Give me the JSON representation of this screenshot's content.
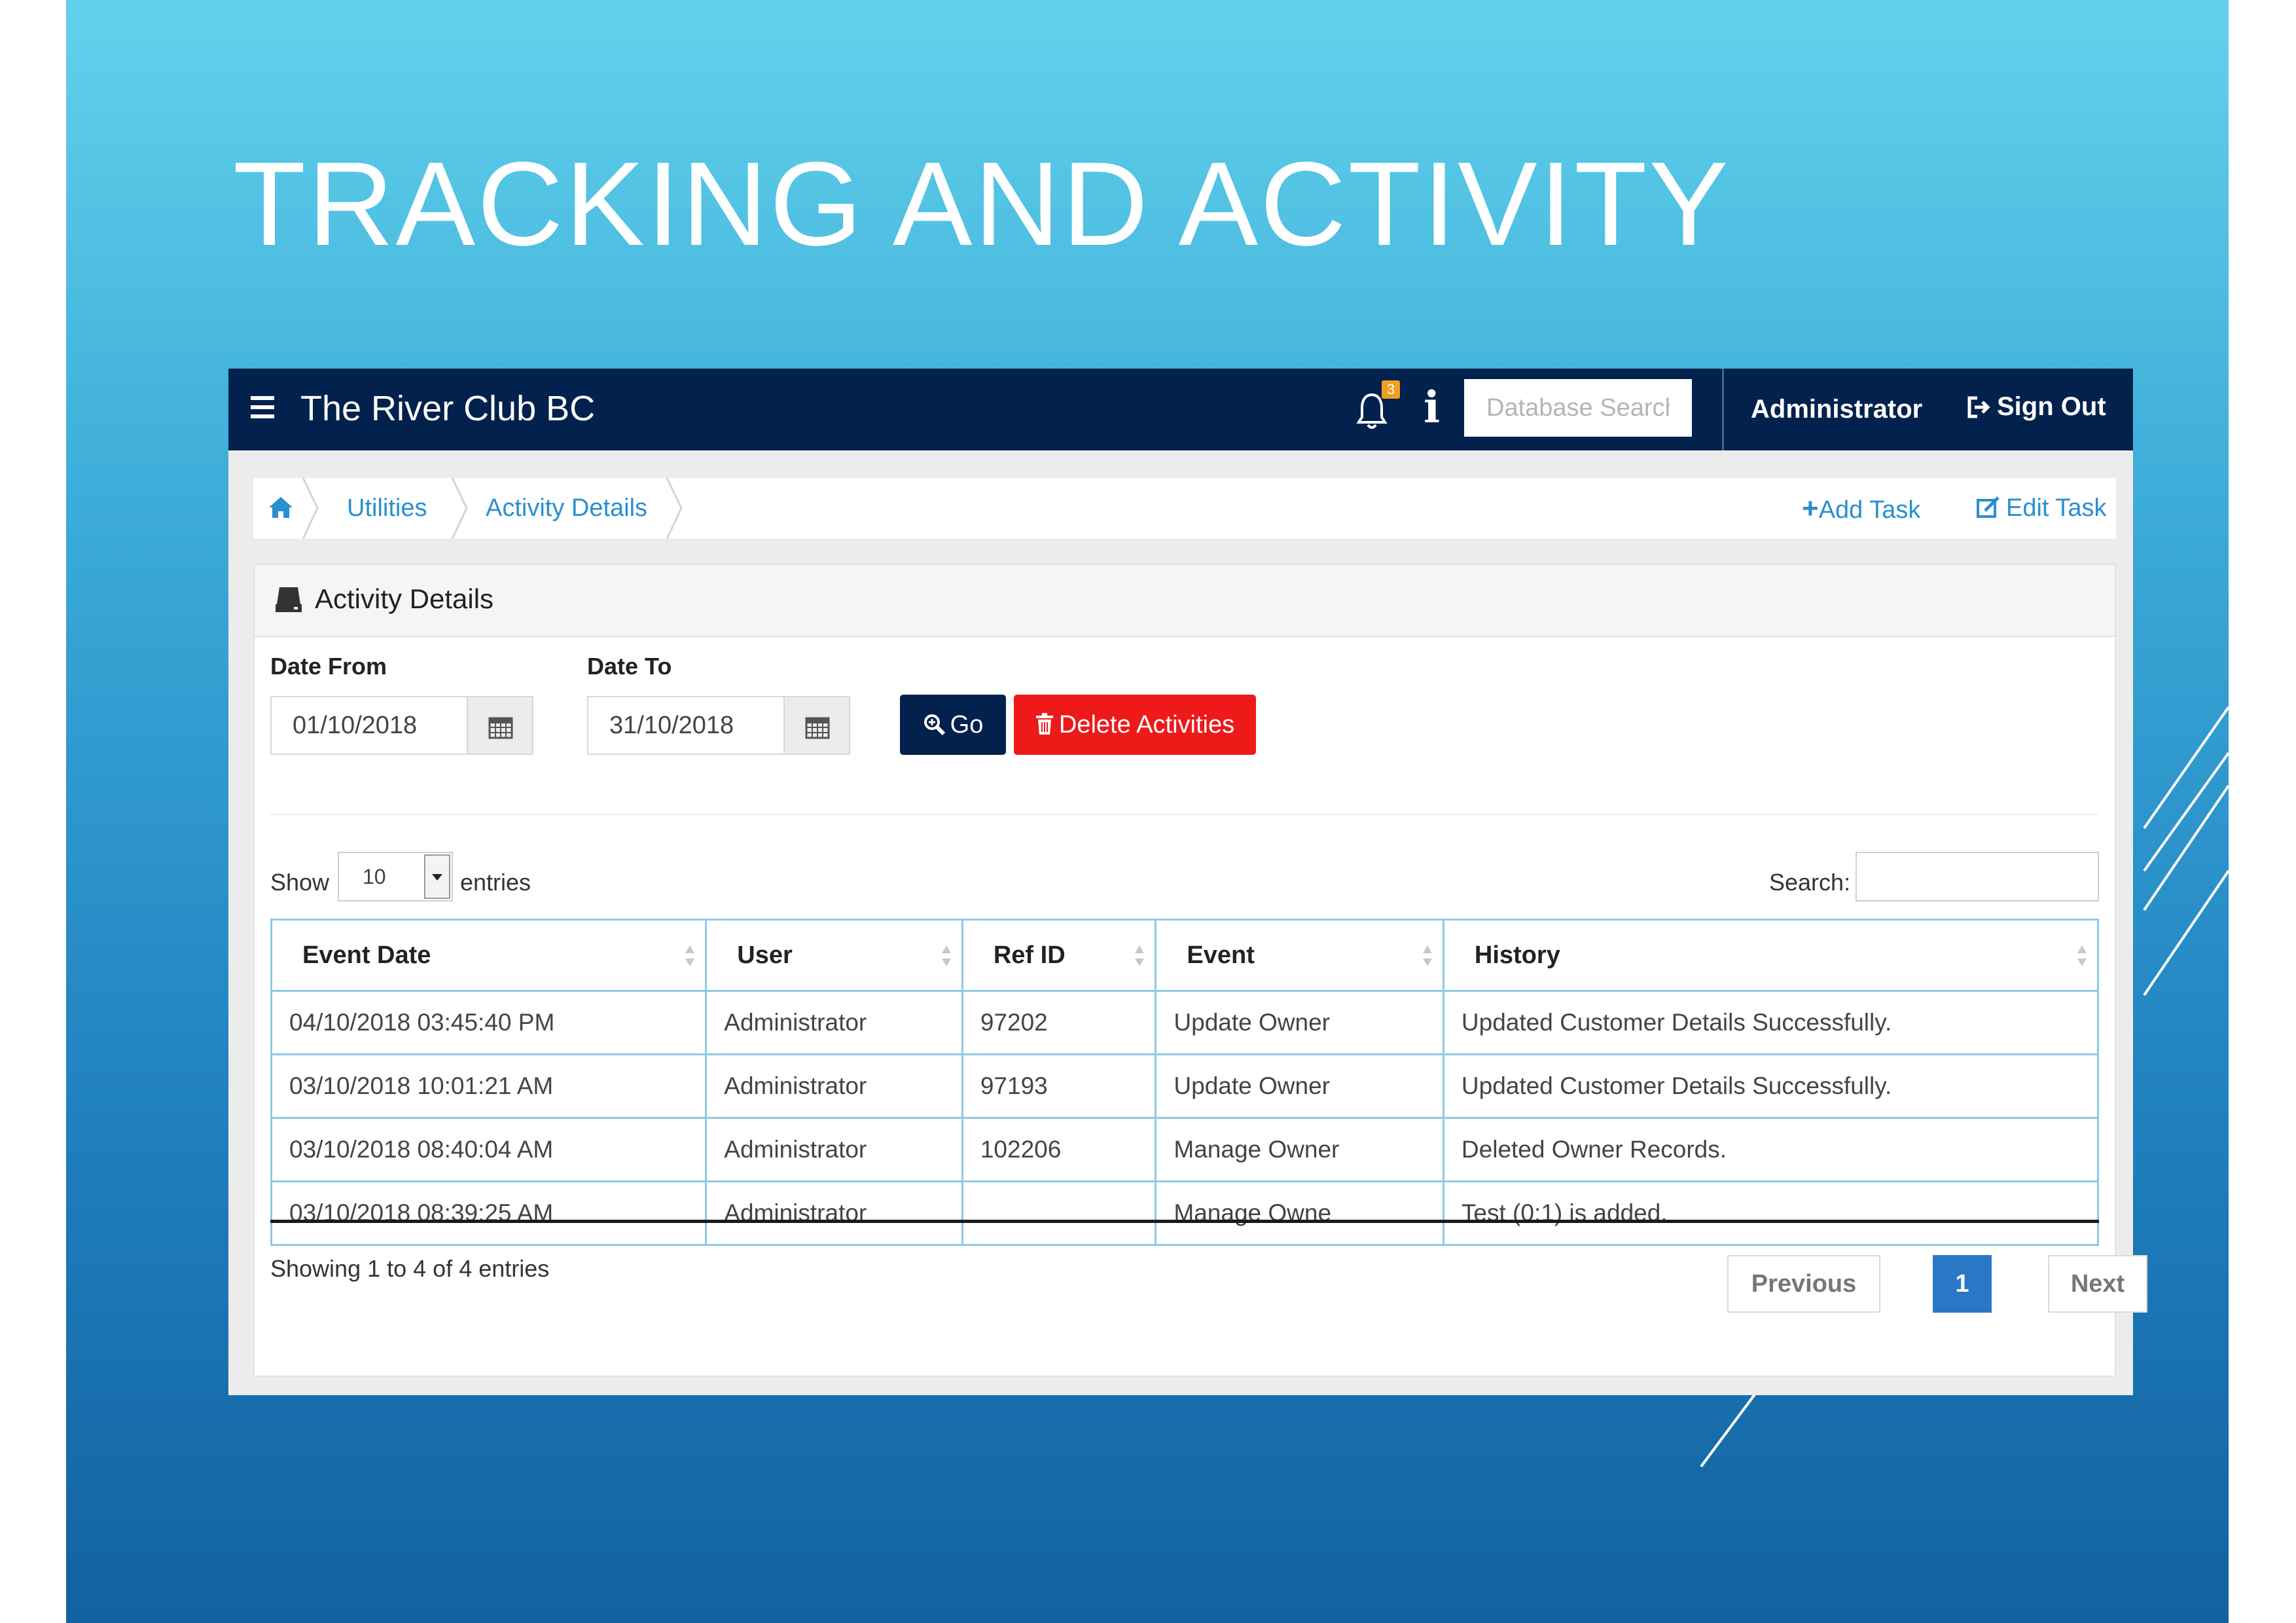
{
  "slide": {
    "title": "TRACKING AND ACTIVITY"
  },
  "topbar": {
    "app_title": "The River Club BC",
    "notification_count": "3",
    "info_label": "i",
    "db_search_placeholder": "Database Search",
    "user_label": "Administrator",
    "signout_label": "Sign Out"
  },
  "breadcrumb": {
    "items": [
      "Utilities",
      "Activity Details"
    ],
    "add_task": "Add Task",
    "edit_task": "Edit Task"
  },
  "panel": {
    "title": "Activity Details",
    "date_from_label": "Date From",
    "date_from_value": "01/10/2018",
    "date_to_label": "Date To",
    "date_to_value": "31/10/2018",
    "go_label": "Go",
    "delete_label": "Delete Activities"
  },
  "table_controls": {
    "show_label": "Show",
    "entries_value": "10",
    "entries_label": "entries",
    "search_label": "Search:"
  },
  "table": {
    "columns": [
      "Event Date",
      "User",
      "Ref ID",
      "Event",
      "History"
    ],
    "rows": [
      [
        "04/10/2018 03:45:40 PM",
        "Administrator",
        "97202",
        "Update Owner",
        "Updated Customer Details Successfully."
      ],
      [
        "03/10/2018 10:01:21 AM",
        "Administrator",
        "97193",
        "Update Owner",
        "Updated Customer Details Successfully."
      ],
      [
        "03/10/2018 08:40:04 AM",
        "Administrator",
        "102206",
        "Manage Owner",
        "Deleted Owner Records."
      ],
      [
        "03/10/2018 08:39:25 AM",
        "Administrator",
        "",
        "Manage Owne",
        "Test (0:1) is added."
      ]
    ]
  },
  "pagination": {
    "info": "Showing 1 to 4 of 4 entries",
    "previous": "Previous",
    "current": "1",
    "next": "Next"
  },
  "colors": {
    "topbar": "#03214d",
    "go_button": "#03214d",
    "delete_button": "#ee1a1a",
    "link": "#2a8fd0",
    "page_current": "#2a78c5"
  }
}
